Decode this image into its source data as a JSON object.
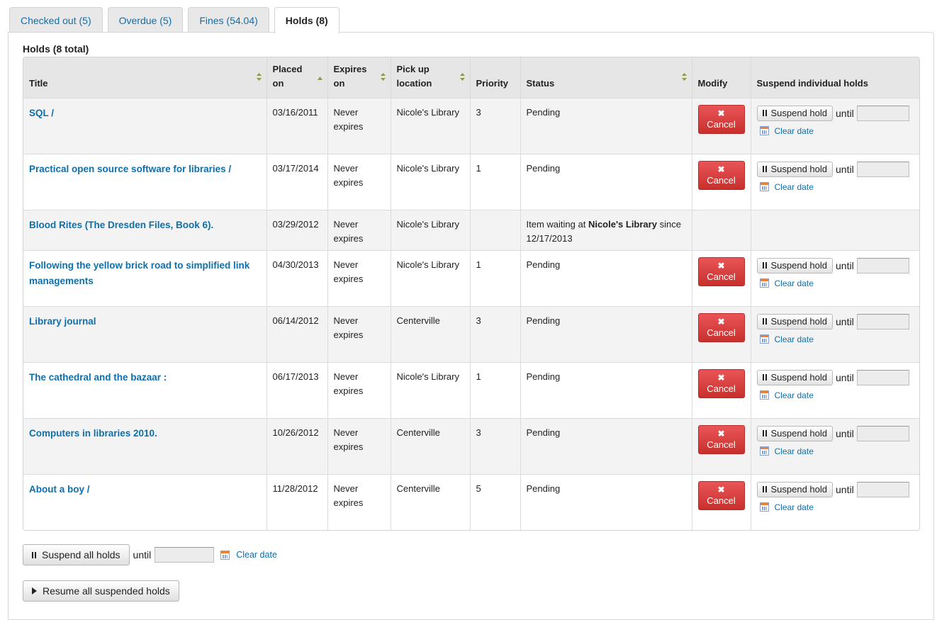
{
  "tabs": [
    {
      "label": "Checked out (5)"
    },
    {
      "label": "Overdue (5)"
    },
    {
      "label": "Fines (54.04)"
    },
    {
      "label": "Holds (8)"
    }
  ],
  "holds_title": "Holds (8 total)",
  "columns": {
    "title": "Title",
    "placed_on_1": "Placed",
    "placed_on_2": "on",
    "expires_on_1": "Expires",
    "expires_on_2": "on",
    "pickup_1": "Pick up",
    "pickup_2": "location",
    "priority": "Priority",
    "status": "Status",
    "modify": "Modify",
    "suspend": "Suspend individual holds"
  },
  "rows": [
    {
      "title": "SQL /",
      "placed": "03/16/2011",
      "expires_1": "Never",
      "expires_2": "expires",
      "pickup": "Nicole's Library",
      "priority": "3",
      "status": "Pending"
    },
    {
      "title": "Practical open source software for libraries /",
      "placed": "03/17/2014",
      "expires_1": "Never",
      "expires_2": "expires",
      "pickup": "Nicole's Library",
      "priority": "1",
      "status": "Pending"
    },
    {
      "title": "Blood Rites (The Dresden Files, Book 6).",
      "placed": "03/29/2012",
      "expires_1": "Never",
      "expires_2": "expires",
      "pickup": "Nicole's Library",
      "priority": "",
      "status_prefix": "Item waiting at ",
      "status_bold": "Nicole's Library",
      "status_suffix": " since",
      "status_date": "12/17/2013"
    },
    {
      "title": "Following the yellow brick road to simplified link managements",
      "placed": "04/30/2013",
      "expires_1": "Never",
      "expires_2": "expires",
      "pickup": "Nicole's Library",
      "priority": "1",
      "status": "Pending"
    },
    {
      "title": "Library journal",
      "placed": "06/14/2012",
      "expires_1": "Never",
      "expires_2": "expires",
      "pickup": "Centerville",
      "priority": "3",
      "status": "Pending"
    },
    {
      "title": "The cathedral and the bazaar :",
      "placed": "06/17/2013",
      "expires_1": "Never",
      "expires_2": "expires",
      "pickup": "Nicole's Library",
      "priority": "1",
      "status": "Pending"
    },
    {
      "title": "Computers in libraries 2010.",
      "placed": "10/26/2012",
      "expires_1": "Never",
      "expires_2": "expires",
      "pickup": "Centerville",
      "priority": "3",
      "status": "Pending"
    },
    {
      "title": "About a boy /",
      "placed": "11/28/2012",
      "expires_1": "Never",
      "expires_2": "expires",
      "pickup": "Centerville",
      "priority": "5",
      "status": "Pending"
    }
  ],
  "actions": {
    "cancel_icon": "✖",
    "cancel_label": "Cancel",
    "suspend_hold_label": "Suspend hold",
    "until_label": "until",
    "clear_date_label": "Clear date"
  },
  "bottom": {
    "suspend_all_label": "Suspend all holds",
    "until_label": "until",
    "clear_date_label": "Clear date",
    "resume_all_label": "Resume all suspended holds"
  },
  "colors": {
    "link": "#0e6fac",
    "cancel": "#d9373a",
    "header_bg": "#e6e6e6"
  }
}
